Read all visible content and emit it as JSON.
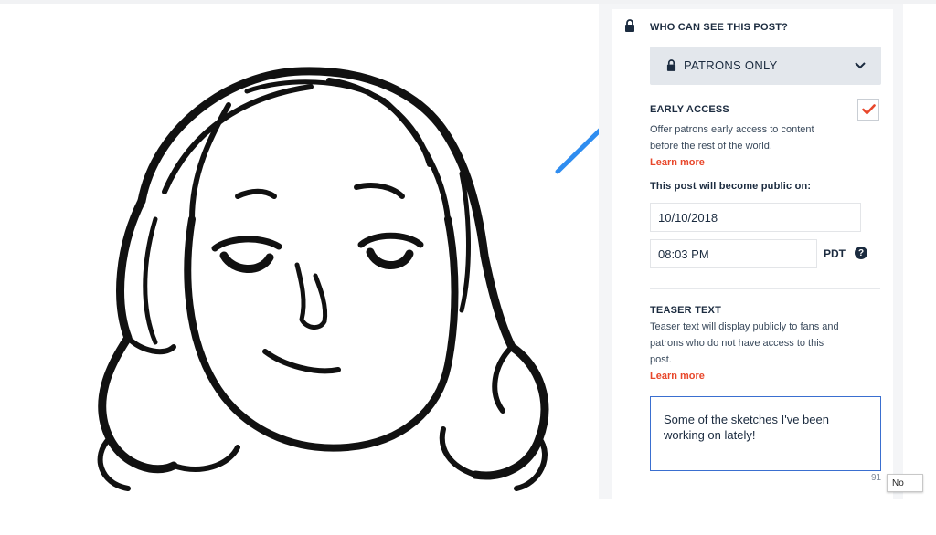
{
  "privacy": {
    "heading": "WHO CAN SEE THIS POST?",
    "selected": "PATRONS ONLY"
  },
  "early_access": {
    "heading": "EARLY ACCESS",
    "checked": true,
    "description_line1": "Offer patrons early access to content",
    "description_line2": "before the rest of the world.",
    "learn_more": "Learn more",
    "public_on_label": "This post will become public on:",
    "date": "10/10/2018",
    "time": "08:03 PM",
    "timezone": "PDT",
    "help_glyph": "?"
  },
  "teaser": {
    "heading": "TEASER TEXT",
    "description_line1": "Teaser text will display publicly to fans and",
    "description_line2": "patrons who do not have access to this",
    "description_line3": "post.",
    "learn_more": "Learn more",
    "value_line1": "Some of the sketches I've been",
    "value_line2": "working on lately!",
    "char_count": "91"
  },
  "tooltip": {
    "text": "No"
  },
  "colors": {
    "accent_red": "#e8472b",
    "focus_blue": "#3a6fd0",
    "arrow_blue": "#2f8df0",
    "navy": "#1b2b3f"
  },
  "icons": [
    "lock-icon",
    "chevron-down-icon",
    "checkmark-icon",
    "question-icon",
    "arrow-annotation"
  ]
}
